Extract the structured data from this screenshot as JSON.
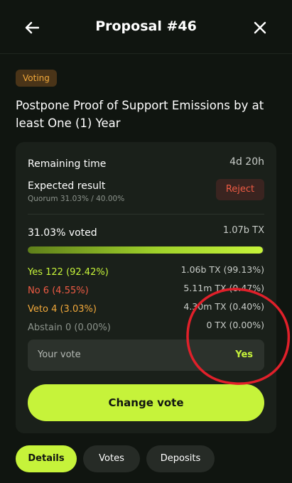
{
  "header": {
    "title": "Proposal #46",
    "back_icon": "arrow-left-icon",
    "close_icon": "close-icon"
  },
  "status_badge": "Voting",
  "proposal_title": "Postpone Proof of Support Emissions by at least One (1) Year",
  "summary": {
    "remaining_time_label": "Remaining time",
    "remaining_time_value": "4d 20h",
    "expected_result_label": "Expected result",
    "expected_result_value": "Reject",
    "quorum_text": "Quorum 31.03% / 40.00%"
  },
  "voting": {
    "voted_label": "31.03% voted",
    "voted_total": "1.07b TX",
    "progress_fraction": 0.995,
    "tallies": [
      {
        "label": "Yes 122 (92.42%)",
        "value": "1.06b TX (99.13%)",
        "kind": "yes"
      },
      {
        "label": "No 6 (4.55%)",
        "value": "5.11m TX (0.47%)",
        "kind": "no"
      },
      {
        "label": "Veto 4 (3.03%)",
        "value": "4.30m TX (0.40%)",
        "kind": "veto"
      },
      {
        "label": "Abstain 0 (0.00%)",
        "value": "0 TX (0.00%)",
        "kind": "abstain"
      }
    ]
  },
  "your_vote": {
    "label": "Your vote",
    "value": "Yes"
  },
  "change_vote_label": "Change vote",
  "tabs": [
    {
      "label": "Details",
      "active": true
    },
    {
      "label": "Votes",
      "active": false
    },
    {
      "label": "Deposits",
      "active": false
    }
  ],
  "colors": {
    "accent": "#c6f33a",
    "reject": "#ef5b44",
    "veto": "#f2a93b",
    "annotation": "#e0202a"
  }
}
